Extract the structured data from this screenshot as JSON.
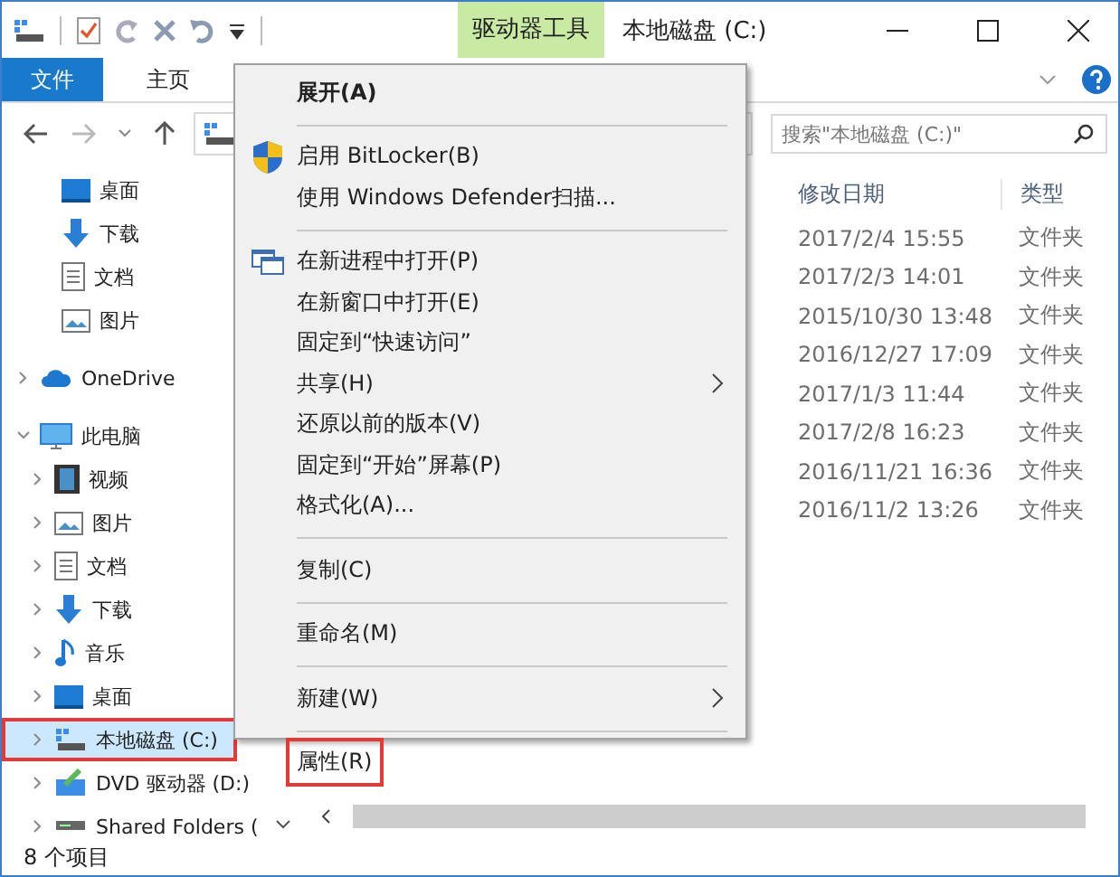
{
  "window": {
    "title": "本地磁盘 (C:)",
    "context_tab": "驱动器工具"
  },
  "ribbon_tabs": [
    {
      "label": "文件",
      "selected": true
    },
    {
      "label": "主页",
      "selected": false
    }
  ],
  "search": {
    "placeholder": "搜索\"本地磁盘 (C:)\""
  },
  "nav": {
    "quick_access": [
      {
        "label": "桌面",
        "kind": "desktop"
      },
      {
        "label": "下载",
        "kind": "download"
      },
      {
        "label": "文档",
        "kind": "document"
      },
      {
        "label": "图片",
        "kind": "picture"
      }
    ],
    "tree": [
      {
        "label": "OneDrive",
        "kind": "cloud",
        "expanded": false,
        "selected": false,
        "outlined": false
      },
      {
        "label": "此电脑",
        "kind": "pc",
        "expanded": true,
        "selected": false,
        "outlined": false,
        "children": [
          {
            "label": "视频",
            "kind": "video",
            "expanded": false,
            "selected": false,
            "outlined": false
          },
          {
            "label": "图片",
            "kind": "picture",
            "expanded": false,
            "selected": false,
            "outlined": false
          },
          {
            "label": "文档",
            "kind": "document",
            "expanded": false,
            "selected": false,
            "outlined": false
          },
          {
            "label": "下载",
            "kind": "download",
            "expanded": false,
            "selected": false,
            "outlined": false
          },
          {
            "label": "音乐",
            "kind": "music",
            "expanded": false,
            "selected": false,
            "outlined": false
          },
          {
            "label": "桌面",
            "kind": "desktop",
            "expanded": false,
            "selected": false,
            "outlined": false
          },
          {
            "label": "本地磁盘 (C:)",
            "kind": "drive",
            "expanded": false,
            "selected": true,
            "outlined": true
          },
          {
            "label": "DVD 驱动器 (D:)",
            "kind": "dvd",
            "expanded": false,
            "selected": false,
            "outlined": false
          },
          {
            "label": "Shared Folders (",
            "kind": "netdrive",
            "expanded": false,
            "selected": false,
            "outlined": false
          }
        ]
      }
    ]
  },
  "table": {
    "columns": [
      "修改日期",
      "类型"
    ],
    "rows": [
      [
        "2017/2/4 15:55",
        "文件夹"
      ],
      [
        "2017/2/3 14:01",
        "文件夹"
      ],
      [
        "2015/10/30 13:48",
        "文件夹"
      ],
      [
        "2016/12/27 17:09",
        "文件夹"
      ],
      [
        "2017/1/3 11:44",
        "文件夹"
      ],
      [
        "2017/2/8 16:23",
        "文件夹"
      ],
      [
        "2016/11/21 16:36",
        "文件夹"
      ],
      [
        "2016/11/2 13:26",
        "文件夹"
      ]
    ]
  },
  "context_menu": [
    {
      "kind": "item",
      "label": "展开(A)",
      "bold": true,
      "submenu": false,
      "outlined": false
    },
    {
      "kind": "separator"
    },
    {
      "kind": "shield",
      "label": "启用 BitLocker(B)",
      "bold": false,
      "submenu": false,
      "outlined": false
    },
    {
      "kind": "item",
      "label": "使用 Windows Defender扫描...",
      "bold": false,
      "submenu": false,
      "outlined": false
    },
    {
      "kind": "separator"
    },
    {
      "kind": "windows",
      "label": "在新进程中打开(P)",
      "bold": false,
      "submenu": false,
      "outlined": false
    },
    {
      "kind": "item",
      "label": "在新窗口中打开(E)",
      "bold": false,
      "submenu": false,
      "outlined": false
    },
    {
      "kind": "item",
      "label": "固定到“快速访问”",
      "bold": false,
      "submenu": false,
      "outlined": false
    },
    {
      "kind": "item",
      "label": "共享(H)",
      "bold": false,
      "submenu": true,
      "outlined": false
    },
    {
      "kind": "item",
      "label": "还原以前的版本(V)",
      "bold": false,
      "submenu": false,
      "outlined": false
    },
    {
      "kind": "item",
      "label": "固定到“开始”屏幕(P)",
      "bold": false,
      "submenu": false,
      "outlined": false
    },
    {
      "kind": "item",
      "label": "格式化(A)...",
      "bold": false,
      "submenu": false,
      "outlined": false
    },
    {
      "kind": "separator"
    },
    {
      "kind": "item",
      "label": "复制(C)",
      "bold": false,
      "submenu": false,
      "outlined": false
    },
    {
      "kind": "separator"
    },
    {
      "kind": "item",
      "label": "重命名(M)",
      "bold": false,
      "submenu": false,
      "outlined": false
    },
    {
      "kind": "separator"
    },
    {
      "kind": "item",
      "label": "新建(W)",
      "bold": false,
      "submenu": true,
      "outlined": false
    },
    {
      "kind": "separator"
    },
    {
      "kind": "item",
      "label": "属性(R)",
      "bold": false,
      "submenu": false,
      "outlined": true
    }
  ],
  "status_bar": "8 个项目"
}
